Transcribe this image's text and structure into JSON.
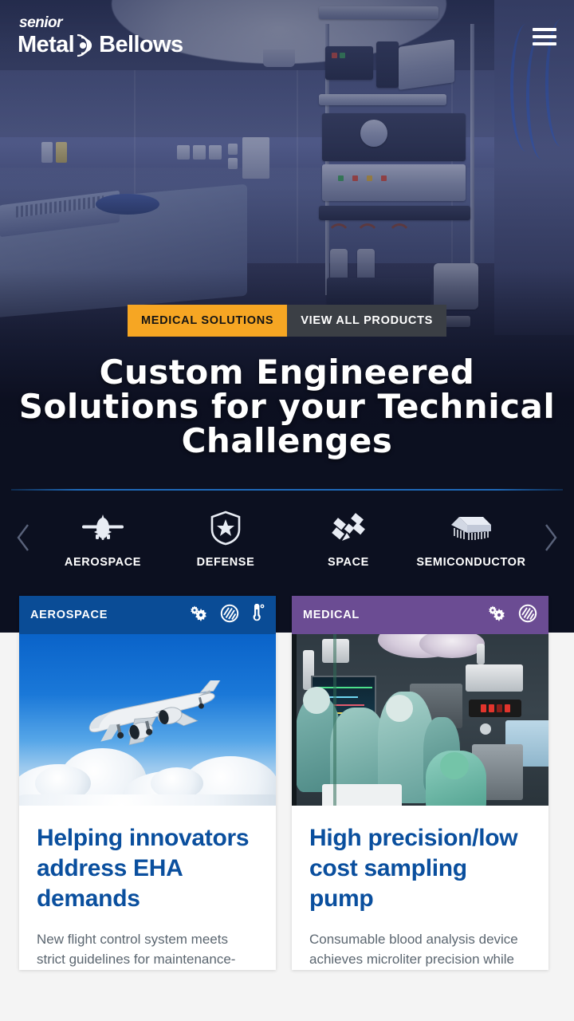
{
  "brand": {
    "logo_top": "senior",
    "logo_word1": "Metal",
    "logo_word2": "Bellows",
    "swoosh_icon": "bellows-swoosh-icon",
    "menu_icon": "hamburger-menu-icon"
  },
  "hero": {
    "background_scene": "operating-room-photo",
    "primary_button": "MEDICAL SOLUTIONS",
    "secondary_button": "VIEW ALL PRODUCTS",
    "title": "Custom Engineered Solutions for your Technical Challenges",
    "accent_color": "#F6A623",
    "secondary_button_color": "#3b3f45"
  },
  "industry_nav": {
    "prev_icon": "chevron-left-icon",
    "next_icon": "chevron-right-icon",
    "rule_color": "#1f69b8",
    "items": [
      {
        "label": "AEROSPACE",
        "icon": "airplane-icon"
      },
      {
        "label": "DEFENSE",
        "icon": "shield-star-icon"
      },
      {
        "label": "SPACE",
        "icon": "satellite-icon"
      },
      {
        "label": "SEMICONDUCTOR",
        "icon": "microchip-icon"
      }
    ]
  },
  "cards": [
    {
      "category": "AEROSPACE",
      "header_color": "#0a4c96",
      "image": "airplane-in-flight-photo",
      "icons": [
        "gears-icon",
        "bellows-icon",
        "thermometer-icon"
      ],
      "title": "Helping innovators address EHA demands",
      "text": "New flight control system meets strict guidelines for maintenance-"
    },
    {
      "category": "MEDICAL",
      "header_color": "#6b4c93",
      "image": "surgical-team-operating-room-photo",
      "icons": [
        "gears-icon",
        "bellows-icon"
      ],
      "title": "High precision/low cost sampling pump",
      "text": "Consumable blood analysis device achieves microliter precision while"
    }
  ]
}
